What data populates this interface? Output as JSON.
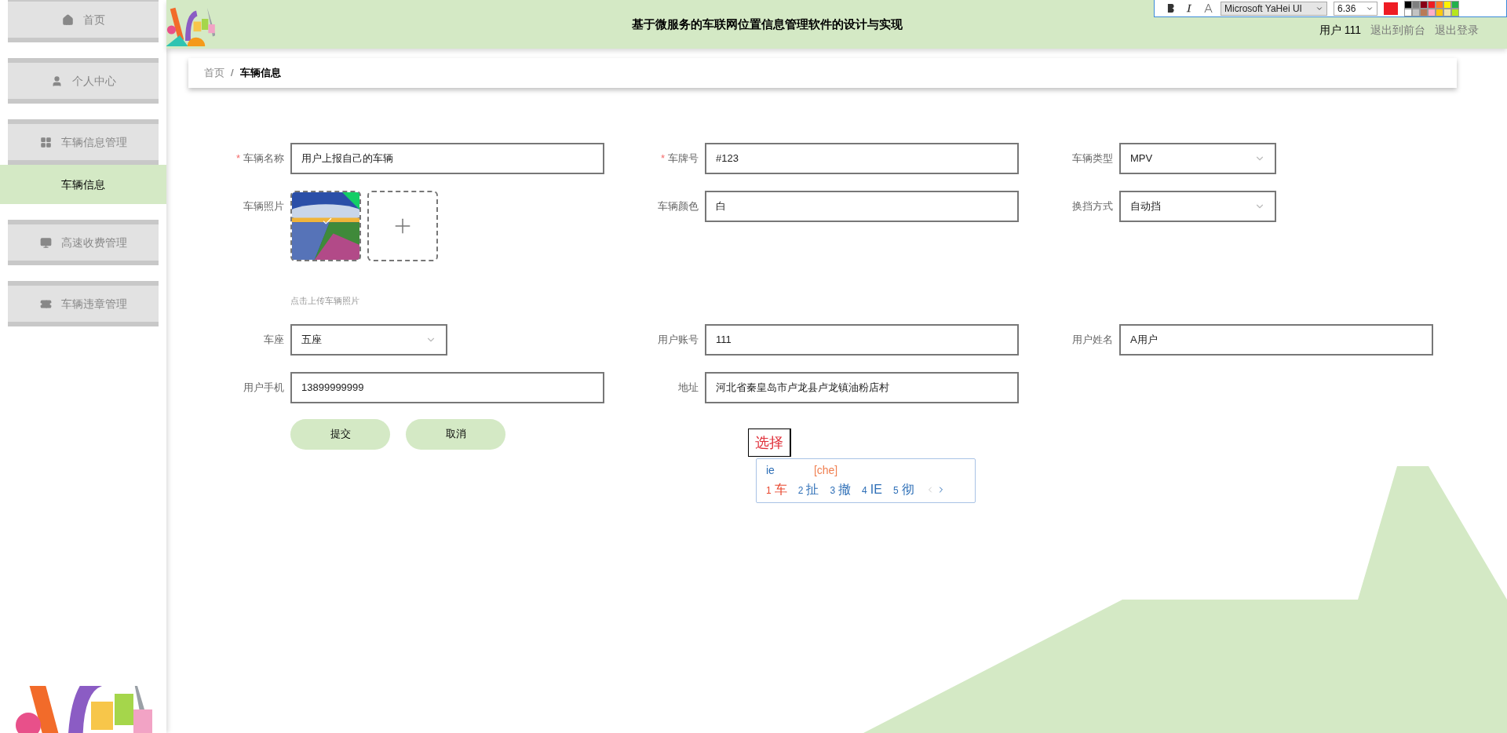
{
  "sidebar": {
    "items": [
      {
        "label": "首页",
        "selected": false
      },
      {
        "label": "个人中心",
        "selected": false
      },
      {
        "label": "车辆信息管理",
        "selected": false,
        "children": [
          {
            "label": "车辆信息",
            "selected": true
          }
        ]
      },
      {
        "label": "高速收费管理",
        "selected": false
      },
      {
        "label": "车辆违章管理",
        "selected": false
      }
    ]
  },
  "header": {
    "title": "基于微服务的车联网位置信息管理软件的设计与实现",
    "user": "用户 111",
    "links": [
      "退出到前台",
      "退出登录"
    ]
  },
  "editor_toolbar": {
    "font": "Microsoft YaHei UI",
    "size": "6.36",
    "color": "#ee1c24"
  },
  "breadcrumb": {
    "items": [
      "首页",
      "车辆信息"
    ],
    "separator": "/"
  },
  "form": {
    "rows": [
      [
        {
          "kind": "input",
          "label": "车辆名称",
          "mark": "*",
          "value": "用户上报自己的车辆"
        },
        {
          "kind": "input",
          "label": "车牌号",
          "mark": "*",
          "value": "#123"
        },
        {
          "kind": "select",
          "label": "车辆类型",
          "value": "MPV"
        }
      ],
      [
        {
          "label": "车辆照片",
          "hint": "点击上传车辆照片"
        },
        {
          "kind": "input",
          "label": "车辆颜色",
          "value": "白"
        },
        {
          "kind": "select",
          "label": "换挡方式",
          "value": "自动挡"
        }
      ],
      [
        {
          "kind": "select",
          "label": "车座",
          "value": "五座"
        },
        {
          "kind": "input",
          "label": "用户账号",
          "value": "111"
        },
        {
          "kind": "input",
          "label": "用户姓名",
          "value": "A用户"
        }
      ],
      [
        {
          "kind": "input",
          "label": "用户手机",
          "value": "13899999999"
        },
        {
          "kind": "input",
          "label": "地址",
          "value": "河北省秦皇岛市卢龙县卢龙镇油粉店村"
        }
      ]
    ],
    "buttons": [
      "提交",
      "取消"
    ]
  },
  "annotation": {
    "text": "选择"
  },
  "ime": {
    "input": "ie",
    "pinyin": "[che]",
    "candidates": [
      {
        "index": "1",
        "text": "车",
        "selected": true
      },
      {
        "index": "2",
        "text": "扯",
        "selected": false
      },
      {
        "index": "3",
        "text": "撤",
        "selected": false
      },
      {
        "index": "4",
        "text": "IE",
        "selected": false
      },
      {
        "index": "5",
        "text": "彻",
        "selected": false
      }
    ]
  }
}
